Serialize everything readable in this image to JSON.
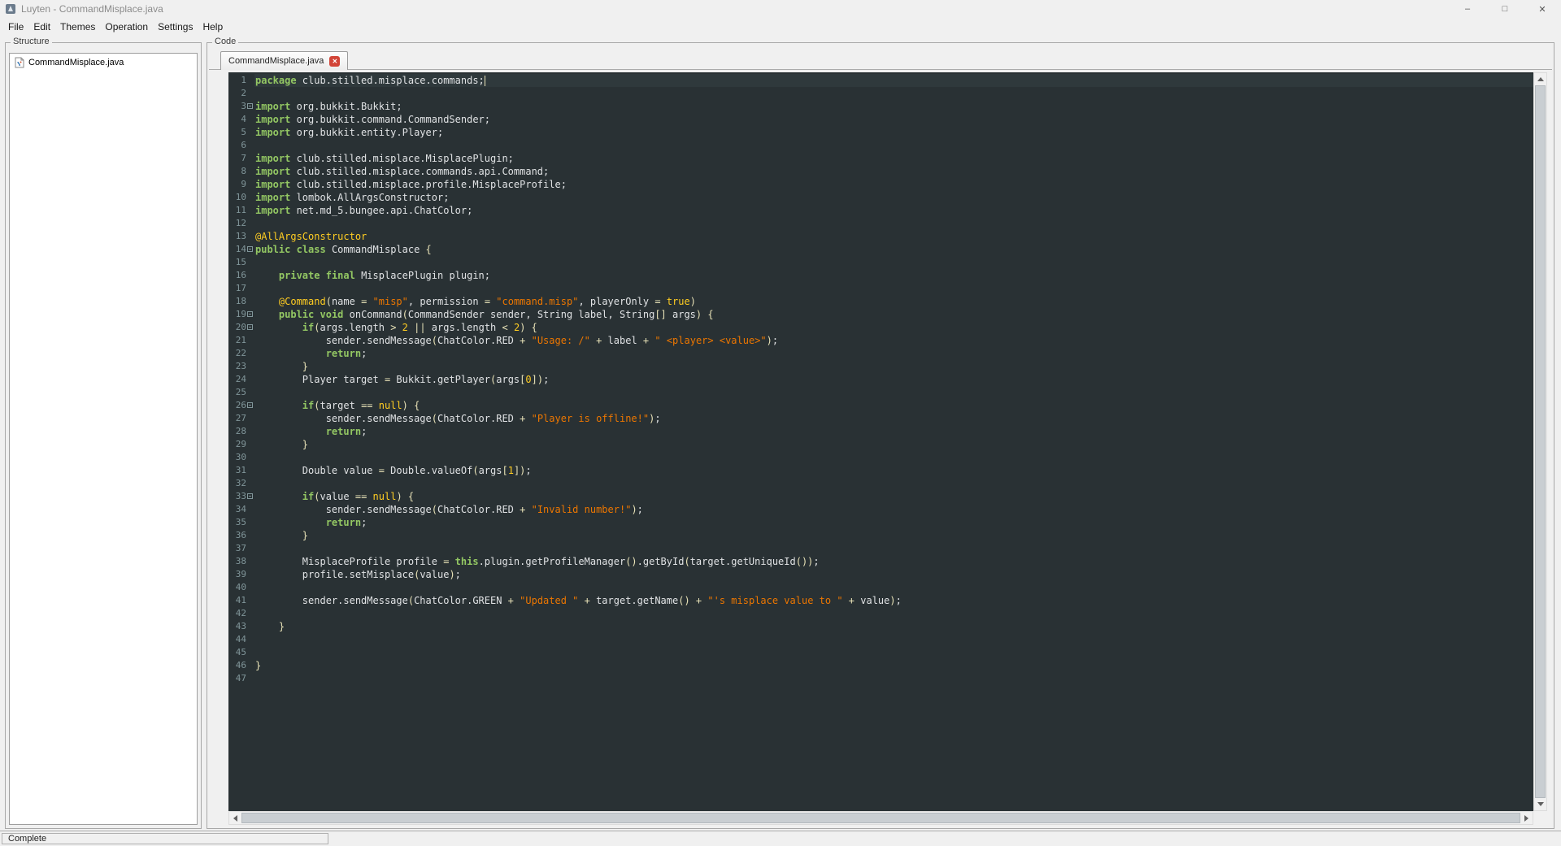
{
  "window": {
    "title": "Luyten - CommandMisplace.java",
    "controls": {
      "minimize": "–",
      "maximize": "□",
      "close": "✕"
    }
  },
  "menu": {
    "items": [
      "File",
      "Edit",
      "Themes",
      "Operation",
      "Settings",
      "Help"
    ]
  },
  "structure_panel": {
    "title": "Structure",
    "items": [
      {
        "icon": "java-file-icon",
        "label": "CommandMisplace.java"
      }
    ]
  },
  "code_panel": {
    "title": "Code",
    "tab": {
      "label": "CommandMisplace.java",
      "close_glyph": "✕"
    }
  },
  "status_bar": {
    "text": "Complete"
  },
  "editor": {
    "colors": {
      "background": "#293134",
      "gutter_fg": "#81969A",
      "current_line_bg": "#2F393C",
      "plain": "#E0E2E4",
      "keyword": "#93C763",
      "string": "#EC7600",
      "number_literal": "#FFCD22",
      "operator": "#E8E2B7",
      "annotation": "#FFCD22"
    },
    "current_line": 1,
    "fold_lines": [
      3,
      14,
      19,
      20,
      26,
      33
    ],
    "lines": [
      [
        [
          "k",
          "package"
        ],
        [
          "p",
          " club.stilled.misplace.commands;"
        ]
      ],
      [],
      [
        [
          "k",
          "import"
        ],
        [
          "p",
          " org.bukkit.Bukkit;"
        ]
      ],
      [
        [
          "k",
          "import"
        ],
        [
          "p",
          " org.bukkit.command.CommandSender;"
        ]
      ],
      [
        [
          "k",
          "import"
        ],
        [
          "p",
          " org.bukkit.entity.Player;"
        ]
      ],
      [],
      [
        [
          "k",
          "import"
        ],
        [
          "p",
          " club.stilled.misplace.MisplacePlugin;"
        ]
      ],
      [
        [
          "k",
          "import"
        ],
        [
          "p",
          " club.stilled.misplace.commands.api.Command;"
        ]
      ],
      [
        [
          "k",
          "import"
        ],
        [
          "p",
          " club.stilled.misplace.profile.MisplaceProfile;"
        ]
      ],
      [
        [
          "k",
          "import"
        ],
        [
          "p",
          " lombok.AllArgsConstructor;"
        ]
      ],
      [
        [
          "k",
          "import"
        ],
        [
          "p",
          " net.md_5.bungee.api.ChatColor;"
        ]
      ],
      [],
      [
        [
          "a",
          "@AllArgsConstructor"
        ]
      ],
      [
        [
          "k",
          "public"
        ],
        [
          "p",
          " "
        ],
        [
          "k",
          "class"
        ],
        [
          "p",
          " CommandMisplace "
        ],
        [
          "o",
          "{"
        ]
      ],
      [],
      [
        [
          "p",
          "    "
        ],
        [
          "k",
          "private"
        ],
        [
          "p",
          " "
        ],
        [
          "k",
          "final"
        ],
        [
          "p",
          " MisplacePlugin plugin;"
        ]
      ],
      [],
      [
        [
          "p",
          "    "
        ],
        [
          "a",
          "@Command"
        ],
        [
          "o",
          "("
        ],
        [
          "p",
          "name "
        ],
        [
          "o",
          "="
        ],
        [
          "p",
          " "
        ],
        [
          "s",
          "\"misp\""
        ],
        [
          "p",
          ", permission "
        ],
        [
          "o",
          "="
        ],
        [
          "p",
          " "
        ],
        [
          "s",
          "\"command.misp\""
        ],
        [
          "p",
          ", playerOnly "
        ],
        [
          "o",
          "="
        ],
        [
          "p",
          " "
        ],
        [
          "n",
          "true"
        ],
        [
          "o",
          ")"
        ]
      ],
      [
        [
          "p",
          "    "
        ],
        [
          "k",
          "public"
        ],
        [
          "p",
          " "
        ],
        [
          "k",
          "void"
        ],
        [
          "p",
          " onCommand"
        ],
        [
          "o",
          "("
        ],
        [
          "p",
          "CommandSender sender, String label, String"
        ],
        [
          "o",
          "[]"
        ],
        [
          "p",
          " args"
        ],
        [
          "o",
          ")"
        ],
        [
          "p",
          " "
        ],
        [
          "o",
          "{"
        ]
      ],
      [
        [
          "p",
          "        "
        ],
        [
          "k",
          "if"
        ],
        [
          "o",
          "("
        ],
        [
          "p",
          "args.length "
        ],
        [
          "o",
          ">"
        ],
        [
          "p",
          " "
        ],
        [
          "n",
          "2"
        ],
        [
          "p",
          " "
        ],
        [
          "o",
          "||"
        ],
        [
          "p",
          " args.length "
        ],
        [
          "o",
          "<"
        ],
        [
          "p",
          " "
        ],
        [
          "n",
          "2"
        ],
        [
          "o",
          ")"
        ],
        [
          "p",
          " "
        ],
        [
          "o",
          "{"
        ]
      ],
      [
        [
          "p",
          "            sender.sendMessage"
        ],
        [
          "o",
          "("
        ],
        [
          "p",
          "ChatColor.RED "
        ],
        [
          "o",
          "+"
        ],
        [
          "p",
          " "
        ],
        [
          "s",
          "\"Usage: /\""
        ],
        [
          "p",
          " "
        ],
        [
          "o",
          "+"
        ],
        [
          "p",
          " label "
        ],
        [
          "o",
          "+"
        ],
        [
          "p",
          " "
        ],
        [
          "s",
          "\" <player> <value>\""
        ],
        [
          "o",
          ")"
        ],
        [
          "p",
          ";"
        ]
      ],
      [
        [
          "p",
          "            "
        ],
        [
          "k",
          "return"
        ],
        [
          "p",
          ";"
        ]
      ],
      [
        [
          "p",
          "        "
        ],
        [
          "o",
          "}"
        ]
      ],
      [
        [
          "p",
          "        Player target "
        ],
        [
          "o",
          "="
        ],
        [
          "p",
          " Bukkit.getPlayer"
        ],
        [
          "o",
          "("
        ],
        [
          "p",
          "args"
        ],
        [
          "o",
          "["
        ],
        [
          "n",
          "0"
        ],
        [
          "o",
          "])"
        ],
        [
          "p",
          ";"
        ]
      ],
      [],
      [
        [
          "p",
          "        "
        ],
        [
          "k",
          "if"
        ],
        [
          "o",
          "("
        ],
        [
          "p",
          "target "
        ],
        [
          "o",
          "=="
        ],
        [
          "p",
          " "
        ],
        [
          "n",
          "null"
        ],
        [
          "o",
          ")"
        ],
        [
          "p",
          " "
        ],
        [
          "o",
          "{"
        ]
      ],
      [
        [
          "p",
          "            sender.sendMessage"
        ],
        [
          "o",
          "("
        ],
        [
          "p",
          "ChatColor.RED "
        ],
        [
          "o",
          "+"
        ],
        [
          "p",
          " "
        ],
        [
          "s",
          "\"Player is offline!\""
        ],
        [
          "o",
          ")"
        ],
        [
          "p",
          ";"
        ]
      ],
      [
        [
          "p",
          "            "
        ],
        [
          "k",
          "return"
        ],
        [
          "p",
          ";"
        ]
      ],
      [
        [
          "p",
          "        "
        ],
        [
          "o",
          "}"
        ]
      ],
      [],
      [
        [
          "p",
          "        Double value "
        ],
        [
          "o",
          "="
        ],
        [
          "p",
          " Double.valueOf"
        ],
        [
          "o",
          "("
        ],
        [
          "p",
          "args"
        ],
        [
          "o",
          "["
        ],
        [
          "n",
          "1"
        ],
        [
          "o",
          "])"
        ],
        [
          "p",
          ";"
        ]
      ],
      [],
      [
        [
          "p",
          "        "
        ],
        [
          "k",
          "if"
        ],
        [
          "o",
          "("
        ],
        [
          "p",
          "value "
        ],
        [
          "o",
          "=="
        ],
        [
          "p",
          " "
        ],
        [
          "n",
          "null"
        ],
        [
          "o",
          ")"
        ],
        [
          "p",
          " "
        ],
        [
          "o",
          "{"
        ]
      ],
      [
        [
          "p",
          "            sender.sendMessage"
        ],
        [
          "o",
          "("
        ],
        [
          "p",
          "ChatColor.RED "
        ],
        [
          "o",
          "+"
        ],
        [
          "p",
          " "
        ],
        [
          "s",
          "\"Invalid number!\""
        ],
        [
          "o",
          ")"
        ],
        [
          "p",
          ";"
        ]
      ],
      [
        [
          "p",
          "            "
        ],
        [
          "k",
          "return"
        ],
        [
          "p",
          ";"
        ]
      ],
      [
        [
          "p",
          "        "
        ],
        [
          "o",
          "}"
        ]
      ],
      [],
      [
        [
          "p",
          "        MisplaceProfile profile "
        ],
        [
          "o",
          "="
        ],
        [
          "p",
          " "
        ],
        [
          "k",
          "this"
        ],
        [
          "p",
          ".plugin.getProfileManager"
        ],
        [
          "o",
          "()"
        ],
        [
          "p",
          ".getById"
        ],
        [
          "o",
          "("
        ],
        [
          "p",
          "target.getUniqueId"
        ],
        [
          "o",
          "())"
        ],
        [
          "p",
          ";"
        ]
      ],
      [
        [
          "p",
          "        profile.setMisplace"
        ],
        [
          "o",
          "("
        ],
        [
          "p",
          "value"
        ],
        [
          "o",
          ")"
        ],
        [
          "p",
          ";"
        ]
      ],
      [],
      [
        [
          "p",
          "        sender.sendMessage"
        ],
        [
          "o",
          "("
        ],
        [
          "p",
          "ChatColor.GREEN "
        ],
        [
          "o",
          "+"
        ],
        [
          "p",
          " "
        ],
        [
          "s",
          "\"Updated \""
        ],
        [
          "p",
          " "
        ],
        [
          "o",
          "+"
        ],
        [
          "p",
          " target.getName"
        ],
        [
          "o",
          "()"
        ],
        [
          "p",
          " "
        ],
        [
          "o",
          "+"
        ],
        [
          "p",
          " "
        ],
        [
          "s",
          "\"'s misplace value to \""
        ],
        [
          "p",
          " "
        ],
        [
          "o",
          "+"
        ],
        [
          "p",
          " value"
        ],
        [
          "o",
          ")"
        ],
        [
          "p",
          ";"
        ]
      ],
      [],
      [
        [
          "p",
          "    "
        ],
        [
          "o",
          "}"
        ]
      ],
      [],
      [],
      [
        [
          "o",
          "}"
        ]
      ],
      []
    ]
  }
}
